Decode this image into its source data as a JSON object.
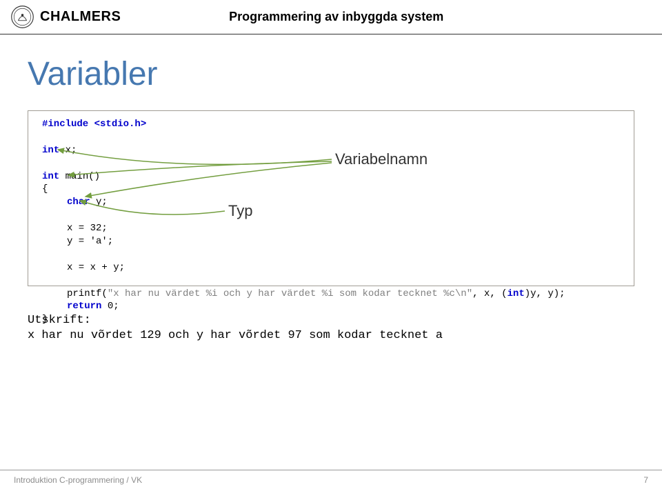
{
  "header": {
    "logo_text": "CHALMERS",
    "title": "Programmering av inbyggda system"
  },
  "page": {
    "title": "Variabler"
  },
  "code": {
    "include": "#include <stdio.h>",
    "int_kw": "int",
    "x_decl": " x;",
    "main_decl": " main()",
    "lbrace": "{",
    "char_kw": "char",
    "y_decl": " y;",
    "assign_x": "x = 32;",
    "assign_y": "y = 'a';",
    "add_line": "x = x + y;",
    "printf_call": "printf(",
    "printf_str": "\"x har nu värdet %i och y har värdet %i som kodar tecknet %c\\n\"",
    "printf_args": ", x, (",
    "printf_cast": ")y, y);",
    "return_kw": "return",
    "return_val": " 0;",
    "rbrace": "}"
  },
  "annotations": {
    "typ": "Typ",
    "variabelnamn": "Variabelnamn"
  },
  "output": {
    "label": "Utskrift:",
    "text": "x har nu võrdet 129 och y har võrdet 97 som kodar tecknet a"
  },
  "footer": {
    "text": "Introduktion C-programmering / VK",
    "page": "7"
  }
}
